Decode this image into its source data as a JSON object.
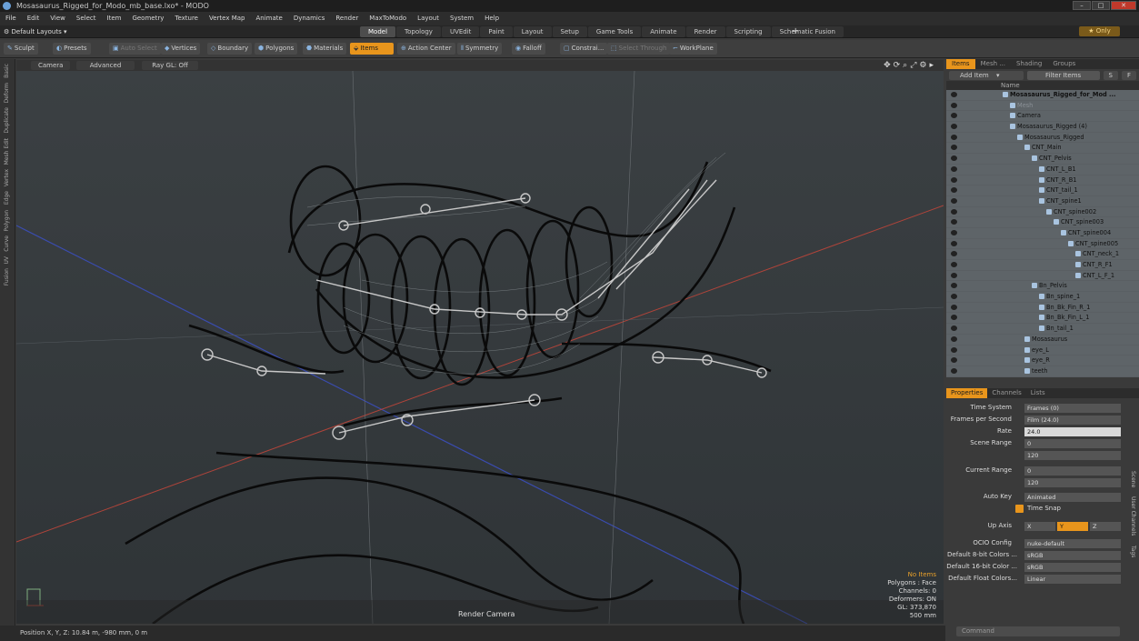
{
  "window": {
    "title": "Mosasaurus_Rigged_for_Modo_mb_base.lxo* - MODO"
  },
  "menu": [
    "File",
    "Edit",
    "View",
    "Select",
    "Item",
    "Geometry",
    "Texture",
    "Vertex Map",
    "Animate",
    "Dynamics",
    "Render",
    "MaxToModo",
    "Layout",
    "System",
    "Help"
  ],
  "layouts": {
    "label": "Default Layouts"
  },
  "tabs": [
    "Model",
    "Topology",
    "UVEdit",
    "Paint",
    "Layout",
    "Setup",
    "Game Tools",
    "Animate",
    "Render",
    "Scripting",
    "Schematic Fusion"
  ],
  "only_label": "Only",
  "toolbar": {
    "sculpt": "Sculpt",
    "presets": "Presets",
    "auto_select": "Auto Select",
    "vertices": "Vertices",
    "boundary": "Boundary",
    "polygons": "Polygons",
    "materials": "Materials",
    "items": "Items",
    "action_center": "Action Center",
    "symmetry": "Symmetry",
    "falloff": "Falloff",
    "constrain": "Constrai...",
    "select_through": "Select Through",
    "workplane": "WorkPlane"
  },
  "left_tabs": [
    "Basic",
    "Deform",
    "Duplicate",
    "Mesh Edit",
    "Vertex",
    "Edge",
    "Polygon",
    "Curve",
    "UV",
    "Fusion"
  ],
  "viewport": {
    "camera": "Camera",
    "advanced": "Advanced",
    "raygl": "Ray GL: Off",
    "render_camera": "Render Camera",
    "info": {
      "no_items": "No Items",
      "polygons": "Polygons : Face",
      "channels": "Channels: 0",
      "deformers": "Deformers: ON",
      "gl": "GL: 373,870",
      "size": "500 mm"
    }
  },
  "status": {
    "position": "Position X, Y, Z:  10.84 m, -980 mm, 0 m"
  },
  "items_panel": {
    "tabs": [
      "Items",
      "Mesh ...",
      "Shading",
      "Groups"
    ],
    "add_item": "Add Item",
    "filter_items": "Filter Items",
    "s": "S",
    "f": "F",
    "name_header": "Name",
    "tree": [
      {
        "label": "Mosasaurus_Rigged_for_Mod ...",
        "indent": 0,
        "bold": true
      },
      {
        "label": "Mesh",
        "indent": 1,
        "dim": true
      },
      {
        "label": "Camera",
        "indent": 1
      },
      {
        "label": "Mosasaurus_Rigged (4)",
        "indent": 1
      },
      {
        "label": "Mosasaurus_Rigged",
        "indent": 2
      },
      {
        "label": "CNT_Main",
        "indent": 3
      },
      {
        "label": "CNT_Pelvis",
        "indent": 4
      },
      {
        "label": "CNT_L_B1",
        "indent": 5
      },
      {
        "label": "CNT_R_B1",
        "indent": 5
      },
      {
        "label": "CNT_tail_1",
        "indent": 5
      },
      {
        "label": "CNT_spine1",
        "indent": 5
      },
      {
        "label": "CNT_spine002",
        "indent": 6
      },
      {
        "label": "CNT_spine003",
        "indent": 7
      },
      {
        "label": "CNT_spine004",
        "indent": 8
      },
      {
        "label": "CNT_spine005",
        "indent": 9
      },
      {
        "label": "CNT_neck_1",
        "indent": 10
      },
      {
        "label": "CNT_R_F1",
        "indent": 10
      },
      {
        "label": "CNT_L_F_1",
        "indent": 10
      },
      {
        "label": "Bn_Pelvis",
        "indent": 4
      },
      {
        "label": "Bn_spine_1",
        "indent": 5
      },
      {
        "label": "Bn_Bk_Fin_R_1",
        "indent": 5
      },
      {
        "label": "Bn_Bk_Fin_L_1",
        "indent": 5
      },
      {
        "label": "Bn_tail_1",
        "indent": 5
      },
      {
        "label": "Mosasaurus",
        "indent": 3
      },
      {
        "label": "eye_L",
        "indent": 3
      },
      {
        "label": "eye_R",
        "indent": 3
      },
      {
        "label": "teeth",
        "indent": 3
      }
    ]
  },
  "properties": {
    "tabs": [
      "Properties",
      "Channels",
      "Lists"
    ],
    "time_system": {
      "label": "Time System",
      "value": "Frames (0)"
    },
    "fps": {
      "label": "Frames per Second",
      "value": "Film (24.0)"
    },
    "rate": {
      "label": "Rate",
      "value": "24.0"
    },
    "scene_range": {
      "label": "Scene Range",
      "start": "0",
      "end": "120"
    },
    "current_range": {
      "label": "Current Range",
      "start": "0",
      "end": "120"
    },
    "auto_key": {
      "label": "Auto Key",
      "value": "Animated"
    },
    "time_snap": "Time Snap",
    "up_axis": {
      "label": "Up Axis",
      "x": "X",
      "y": "Y",
      "z": "Z"
    },
    "ocio": {
      "label": "OCIO Config",
      "value": "nuke-default"
    },
    "c8": {
      "label": "Default 8-bit Colors ...",
      "value": "sRGB"
    },
    "c16": {
      "label": "Default 16-bit Color ...",
      "value": "sRGB"
    },
    "cf": {
      "label": "Default Float Colors...",
      "value": "Linear"
    },
    "side_tabs": [
      "Scene",
      "User Channels",
      "Tags"
    ]
  },
  "command": {
    "placeholder": "Command"
  }
}
